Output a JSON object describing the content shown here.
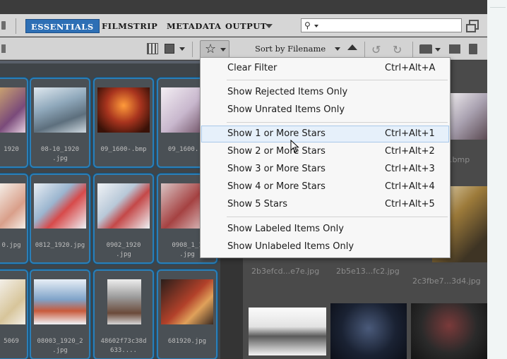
{
  "workspace": {
    "tabs": [
      {
        "label": "ESSENTIALS",
        "active": true
      },
      {
        "label": "FILMSTRIP",
        "active": false
      },
      {
        "label": "METADATA",
        "active": false
      },
      {
        "label": "OUTPUT",
        "active": false
      }
    ],
    "search_placeholder": ""
  },
  "toolbar": {
    "sort_label": "Sort by Filename"
  },
  "filter_menu": {
    "items": [
      {
        "label": "Clear Filter",
        "shortcut": "Ctrl+Alt+A"
      },
      {
        "label": "Show Rejected Items Only",
        "shortcut": ""
      },
      {
        "label": "Show Unrated Items Only",
        "shortcut": ""
      },
      {
        "label": "Show 1 or More Stars",
        "shortcut": "Ctrl+Alt+1",
        "highlighted": true
      },
      {
        "label": "Show 2 or More Stars",
        "shortcut": "Ctrl+Alt+2"
      },
      {
        "label": "Show 3 or More Stars",
        "shortcut": "Ctrl+Alt+3"
      },
      {
        "label": "Show 4 or More Stars",
        "shortcut": "Ctrl+Alt+4"
      },
      {
        "label": "Show 5 Stars",
        "shortcut": "Ctrl+Alt+5"
      },
      {
        "label": "Show Labeled Items Only",
        "shortcut": ""
      },
      {
        "label": "Show Unlabeled Items Only",
        "shortcut": ""
      }
    ]
  },
  "content_left": {
    "captions": [
      "1920",
      "08-10_1920\n.jpg",
      "09_1600-.bmp",
      "09_1600...",
      "0.jpg",
      "0812_1920.jpg",
      "0902_1920\n.jpg",
      "0908_1_1\n.jpg",
      "5069",
      "08003_1920_2\n.jpg",
      "48602f73c38d\n633....",
      "681920.jpg"
    ]
  },
  "content_right": {
    "captions": [
      "0.bmp",
      "2b3efcd...e7e.jpg",
      "2b5e13...fc2.jpg",
      "2c3fbe7...3d4.jpg"
    ]
  },
  "colors": {
    "accent": "#2d6fb5",
    "selection_border": "#2a7fb8",
    "menu_highlight": "#e6f0fa"
  }
}
